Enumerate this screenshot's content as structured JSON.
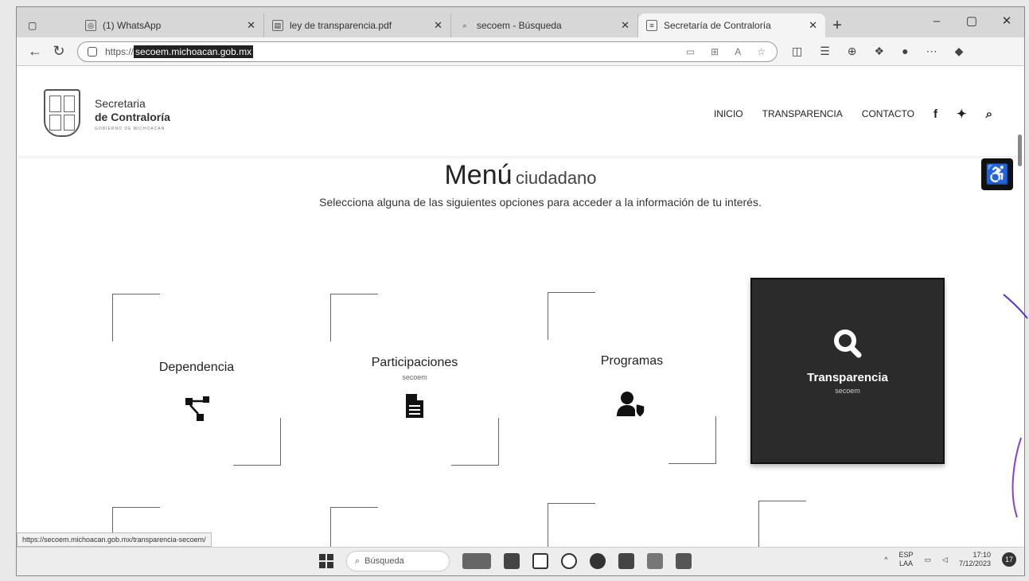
{
  "browser": {
    "tabs": [
      {
        "label": "(1) WhatsApp",
        "icon": "whatsapp-icon",
        "active": false
      },
      {
        "label": "ley de transparencia.pdf",
        "icon": "pdf-icon",
        "active": false
      },
      {
        "label": "secoem - Búsqueda",
        "icon": "search-icon",
        "active": false
      },
      {
        "label": "Secretaría de Contraloría",
        "icon": "page-icon",
        "active": true
      }
    ],
    "url_prefix": "https://",
    "url_host": "secoem.michoacan.gob.mx",
    "status_url": "https://secoem.michoacan.gob.mx/transparencia-secoem/"
  },
  "site": {
    "brand_line1": "Secretaria",
    "brand_line2": "de Contraloría",
    "brand_tagline": "GOBIERNO DE MICHOACÁN",
    "nav": [
      "INICIO",
      "TRANSPARENCIA",
      "CONTACTO"
    ],
    "title_big": "Menú",
    "title_small": "ciudadano",
    "subtitle": "Selecciona alguna de las siguientes opciones para acceder a la información de tu interés.",
    "cards": [
      {
        "title": "Dependencia",
        "sub": "",
        "icon": "sitemap-icon"
      },
      {
        "title": "Participaciones",
        "sub": "secoem",
        "icon": "document-icon"
      },
      {
        "title": "Programas",
        "sub": "",
        "icon": "user-shield-icon"
      },
      {
        "title": "Transparencia",
        "sub": "secoem",
        "icon": "search-icon"
      }
    ]
  },
  "taskbar": {
    "search_placeholder": "Búsqueda",
    "lang_top": "ESP",
    "lang_bottom": "LAA",
    "time": "17:10",
    "date": "7/12/2023",
    "notifications": "17"
  }
}
